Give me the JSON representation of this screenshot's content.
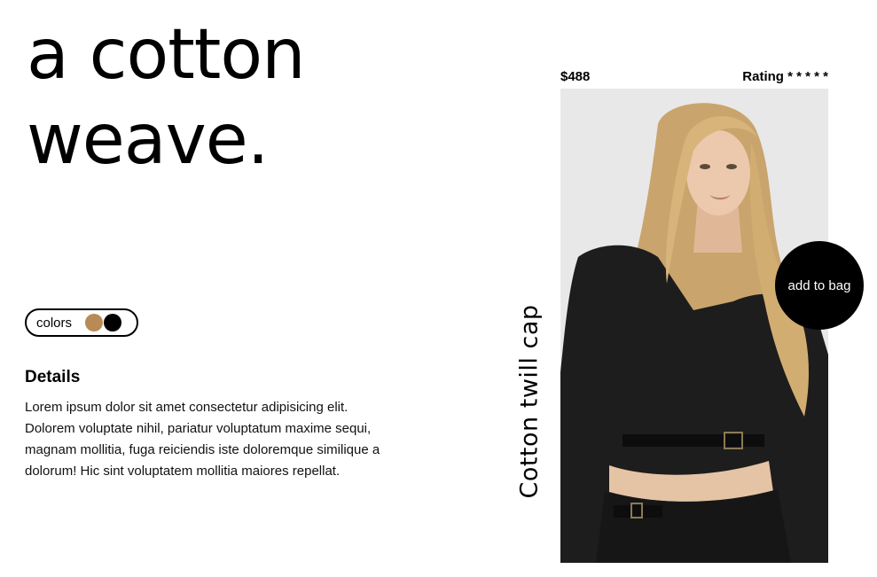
{
  "hero": {
    "line1": "a cotton",
    "line2": "weave."
  },
  "colors": {
    "label": "colors",
    "swatches": [
      "#b88a55",
      "#000000"
    ]
  },
  "details": {
    "heading": "Details",
    "body": "Lorem ipsum dolor sit amet consectetur adipisicing elit. Dolorem voluptate nihil, pariatur voluptatum maxime sequi, magnam mollitia, fuga reiciendis iste doloremque similique a dolorum! Hic sint voluptatem mollitia maiores repellat."
  },
  "product": {
    "price": "$488",
    "rating_label": "Rating",
    "rating_stars": "* * * * *",
    "name": "Cotton twill cap",
    "add_to_bag": "add to bag",
    "image_icon": "model-photo"
  }
}
